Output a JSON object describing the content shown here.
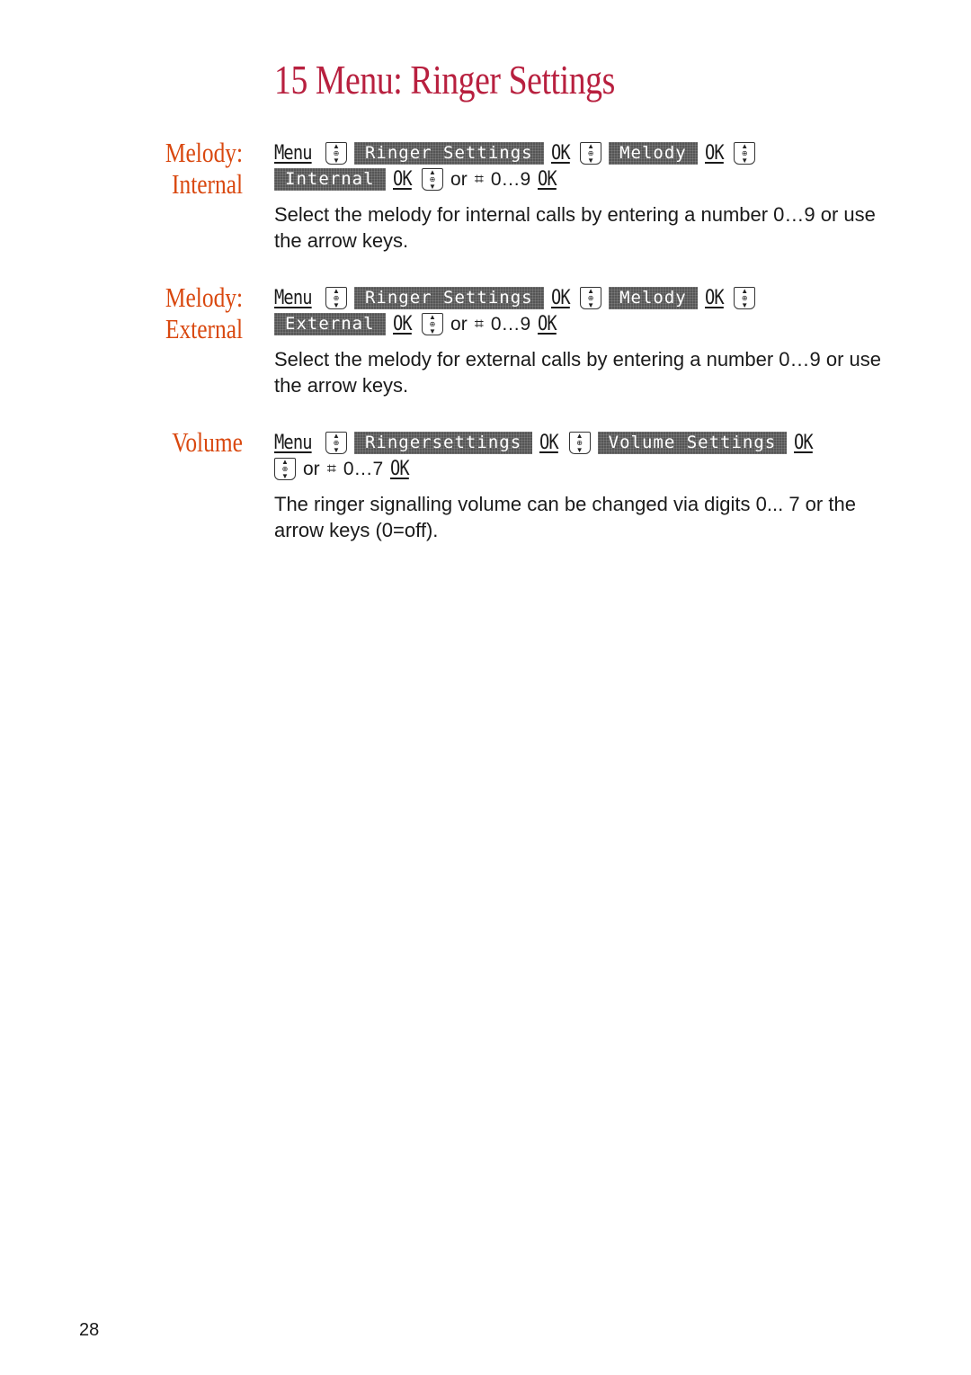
{
  "page": {
    "title": "15 Menu: Ringer Settings",
    "page_number": "28",
    "colors": {
      "title": "#b8203f",
      "section_label": "#d9480f"
    }
  },
  "sections": [
    {
      "label_line1": "Melody:",
      "label_line2": "Internal",
      "steps": {
        "menu": "Menu",
        "screen1": "Ringer Settings",
        "ok1": "OK",
        "screen2": "Melody",
        "ok2": "OK",
        "screen3": "Internal",
        "ok3": "OK",
        "or": "or",
        "range": "0…9",
        "ok4": "OK"
      },
      "description": "Select the melody for internal calls by entering a number 0…9 or use the arrow keys."
    },
    {
      "label_line1": "Melody:",
      "label_line2": "External",
      "steps": {
        "menu": "Menu",
        "screen1": "Ringer Settings",
        "ok1": "OK",
        "screen2": "Melody",
        "ok2": "OK",
        "screen3": "External",
        "ok3": "OK",
        "or": "or",
        "range": "0…9",
        "ok4": "OK"
      },
      "description": "Select the melody for external calls by entering a number 0…9 or use the arrow keys."
    },
    {
      "label_line1": "Volume",
      "steps": {
        "menu": "Menu",
        "screen1": "Ringersettings",
        "ok1": "OK",
        "screen2": "Volume Settings",
        "ok2": "OK",
        "or": "or",
        "range": "0…7",
        "ok3": "OK"
      },
      "description": "The ringer signalling volume can be changed via digits 0... 7 or the arrow keys (0=off)."
    }
  ],
  "icons": {
    "navkey": "navigation-key-icon",
    "keypad": "keypad-hand-icon"
  }
}
